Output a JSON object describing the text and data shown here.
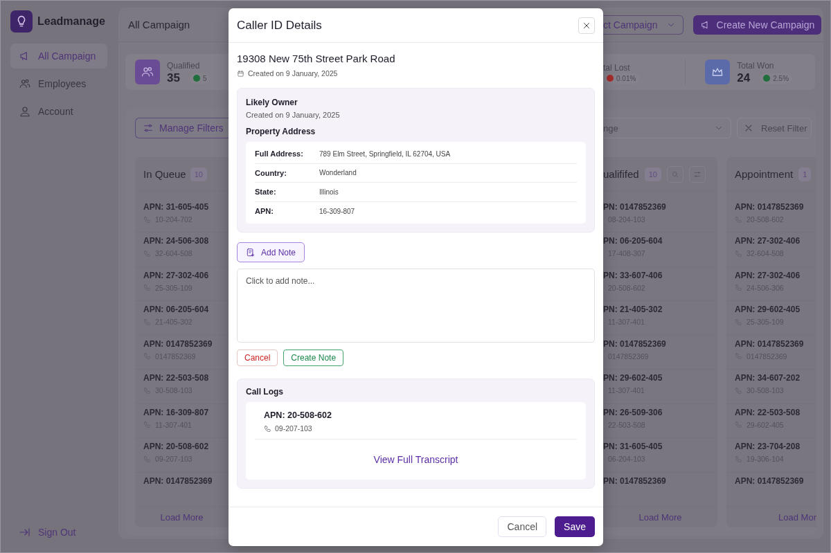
{
  "sidebar": {
    "logo": "Leadmanage",
    "items": [
      {
        "label": "All Campaign",
        "selected": true
      },
      {
        "label": "Employees",
        "selected": false
      },
      {
        "label": "Account",
        "selected": false
      }
    ],
    "sign_out": "Sign Out"
  },
  "header": {
    "title": "All Campaign",
    "campaign_select": "ct Campaign",
    "create_button": "Create New Campaign"
  },
  "stats": [
    {
      "label": "Qualified",
      "value": "35",
      "change": "5",
      "negative": false
    },
    {
      "label": "tal Lost",
      "change": "0.01%",
      "negative": true
    },
    {
      "label": "Total Won",
      "value": "24",
      "change": "2.5%",
      "negative": false
    }
  ],
  "filters": {
    "manage_button": "Manage Filters",
    "date_select": "nge",
    "reset_button": "Reset Filter"
  },
  "columns": [
    {
      "title": "In Queue",
      "count": "10",
      "tools": false,
      "phone_icons": true,
      "load_more": "Load More",
      "rows": [
        {
          "apn": "APN: 31-605-405",
          "phone": "10-204-702"
        },
        {
          "apn": "APN: 24-506-308",
          "phone": "32-604-508"
        },
        {
          "apn": "APN: 27-302-406",
          "phone": "25-305-109"
        },
        {
          "apn": "APN: 06-205-604",
          "phone": "21-405-302"
        },
        {
          "apn": "APN: 0147852369",
          "phone": "0147852369"
        },
        {
          "apn": "APN: 22-503-508",
          "phone": "30-508-103"
        },
        {
          "apn": "APN: 16-309-807",
          "phone": "11-307-401"
        },
        {
          "apn": "APN: 20-508-602",
          "phone": "09-207-103"
        },
        {
          "apn": "APN: 0147852369"
        }
      ]
    },
    {
      "title": "ualififed",
      "count": "10",
      "tools": true,
      "phone_icons": false,
      "load_more": "Load More",
      "rows": [
        {
          "apn": "PN: 0147852369",
          "phone": "08-204-103"
        },
        {
          "apn": "PN: 06-205-604",
          "phone": "17-408-307"
        },
        {
          "apn": "PN: 33-607-406",
          "phone": "20-508-602"
        },
        {
          "apn": "PN: 21-405-302",
          "phone": "11-307-401"
        },
        {
          "apn": "PN: 0147852369",
          "phone": "0147852369"
        },
        {
          "apn": "PN: 29-602-405",
          "phone": "11-307-401"
        },
        {
          "apn": "PN: 26-509-306",
          "phone": "22-503-508"
        },
        {
          "apn": "PN: 31-605-405",
          "phone": "06-204-103"
        },
        {
          "apn": "PN: 0147852369"
        }
      ]
    },
    {
      "title": "Appointment",
      "count": "1",
      "tools": false,
      "phone_icons": true,
      "load_more": "Load Mor",
      "rows": [
        {
          "apn": "APN: 0147852369",
          "phone": "20-508-602"
        },
        {
          "apn": "APN: 27-302-406",
          "phone": "32-604-508"
        },
        {
          "apn": "APN: 27-302-406",
          "phone": "24-506-306"
        },
        {
          "apn": "APN: 29-602-405",
          "phone": "25-305-109"
        },
        {
          "apn": "APN: 0147852369",
          "phone": "0147852369"
        },
        {
          "apn": "APN: 34-607-202",
          "phone": "30-508-103"
        },
        {
          "apn": "APN: 22-503-508",
          "phone": "29-602-405"
        },
        {
          "apn": "APN: 23-704-208",
          "phone": "19-306-104"
        },
        {
          "apn": "APN: 0147852369"
        }
      ]
    }
  ],
  "modal": {
    "title": "Caller ID Details",
    "property": "19308 New 75th Street Park Road",
    "created": "Created on 9 January, 2025",
    "owner": {
      "heading": "Likely Owner",
      "created": "Created on 9 January, 2025",
      "address_heading": "Property Address",
      "fields": [
        {
          "label": "Full Address:",
          "value": "789 Elm Street, Springfield, IL 62704, USA"
        },
        {
          "label": "Country:",
          "value": "Wonderland"
        },
        {
          "label": "State:",
          "value": "Illinois"
        },
        {
          "label": "APN:",
          "value": "16-309-807"
        }
      ]
    },
    "add_note_button": "Add Note",
    "note": {
      "placeholder": "Click to add note..."
    },
    "note_cancel": "Cancel",
    "create_note": "Create Note",
    "call_logs": {
      "heading": "Call Logs",
      "entries": [
        {
          "apn": "APN: 20-508-602",
          "phone": "09-207-103"
        }
      ],
      "transcript_link": "View Full Transcript"
    },
    "footer": {
      "cancel": "Cancel",
      "save": "Save"
    }
  }
}
